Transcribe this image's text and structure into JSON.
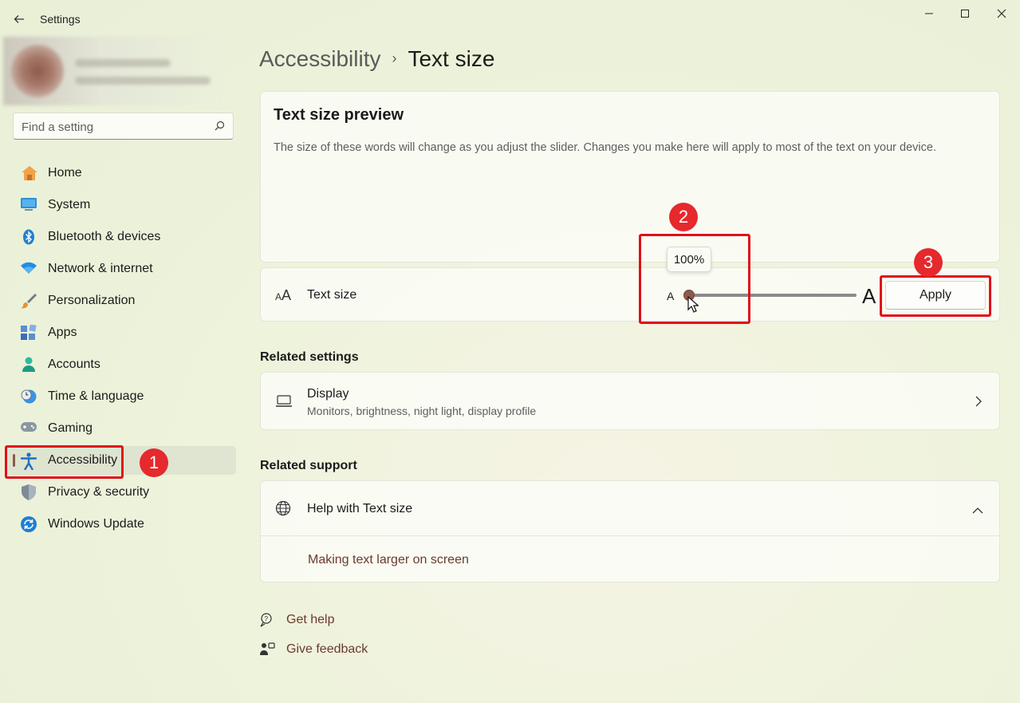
{
  "window": {
    "title": "Settings",
    "back_icon": "back-arrow-icon",
    "controls": [
      "minimize-icon",
      "maximize-icon",
      "close-icon"
    ]
  },
  "search": {
    "placeholder": "Find a setting"
  },
  "sidebar": {
    "items": [
      {
        "label": "Home",
        "icon": "home-icon"
      },
      {
        "label": "System",
        "icon": "system-icon"
      },
      {
        "label": "Bluetooth & devices",
        "icon": "bluetooth-icon"
      },
      {
        "label": "Network & internet",
        "icon": "wifi-icon"
      },
      {
        "label": "Personalization",
        "icon": "brush-icon"
      },
      {
        "label": "Apps",
        "icon": "apps-icon"
      },
      {
        "label": "Accounts",
        "icon": "person-icon"
      },
      {
        "label": "Time & language",
        "icon": "clock-globe-icon"
      },
      {
        "label": "Gaming",
        "icon": "gamepad-icon"
      },
      {
        "label": "Accessibility",
        "icon": "accessibility-icon",
        "selected": true
      },
      {
        "label": "Privacy & security",
        "icon": "shield-icon"
      },
      {
        "label": "Windows Update",
        "icon": "update-icon"
      }
    ]
  },
  "breadcrumb": {
    "parent": "Accessibility",
    "separator": "›",
    "current": "Text size"
  },
  "preview": {
    "title": "Text size preview",
    "description": "The size of these words will change as you adjust the slider. Changes you make here will apply to most of the text on your device."
  },
  "text_size": {
    "label": "Text size",
    "small_a": "A",
    "large_a": "A",
    "tooltip": "100%",
    "slider_fraction": 0.0,
    "apply_label": "Apply"
  },
  "related_settings": {
    "title": "Related settings",
    "display": {
      "title": "Display",
      "subtitle": "Monitors, brightness, night light, display profile"
    }
  },
  "related_support": {
    "title": "Related support",
    "help_title": "Help with Text size",
    "link": "Making text larger on screen"
  },
  "footer": {
    "get_help": "Get help",
    "give_feedback": "Give feedback"
  },
  "annotations": {
    "badge1": "1",
    "badge2": "2",
    "badge3": "3",
    "color": "#e0101a"
  },
  "colors": {
    "accent": "#8e5a4c",
    "link": "#6b3a2e",
    "annotation_red": "#e0101a"
  }
}
